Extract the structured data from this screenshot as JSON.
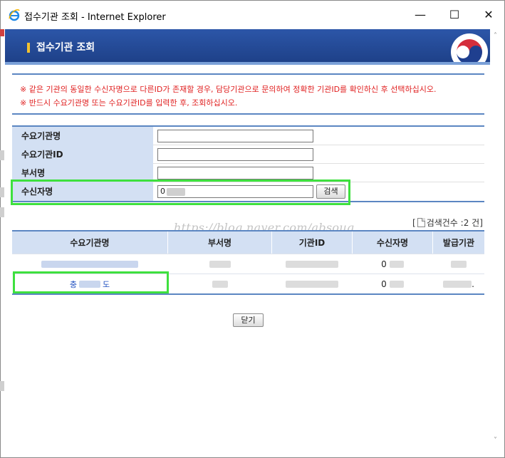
{
  "window": {
    "title": "접수기관 조회 - Internet Explorer",
    "min_icon": "—",
    "max_icon": "☐",
    "close_icon": "✕"
  },
  "header": {
    "title": "접수기관 조회"
  },
  "notices": [
    "※ 같은 기관의 동일한 수신자명으로 다른ID가 존재할 경우, 담당기관으로 문의하여 정확한 기관ID를 확인하신 후 선택하십시오.",
    "※ 반드시 수요기관명 또는 수요기관ID를 입력한 후, 조회하십시오."
  ],
  "form": {
    "fields": [
      {
        "label": "수요기관명",
        "value": ""
      },
      {
        "label": "수요기관ID",
        "value": ""
      },
      {
        "label": "부서명",
        "value": ""
      },
      {
        "label": "수신자명",
        "value": "0"
      }
    ],
    "search_label": "검색"
  },
  "result": {
    "count_open": "[",
    "count_text": "검색건수 :2 건]",
    "watermark": "https://blog.naver.com/absoug",
    "columns": [
      "수요기관명",
      "부서명",
      "기관ID",
      "수신자명",
      "발급기관"
    ],
    "rows": [
      {
        "org": "",
        "receiver": "0"
      },
      {
        "org_prefix": "충",
        "org_suffix": "도",
        "receiver": "0",
        "issuer_suffix": "."
      }
    ]
  },
  "close_label": "닫기",
  "colors": {
    "accent": "#2c56a8",
    "highlight": "#3ee03e",
    "notice": "#e02020",
    "label_bg": "#d3e0f3"
  }
}
